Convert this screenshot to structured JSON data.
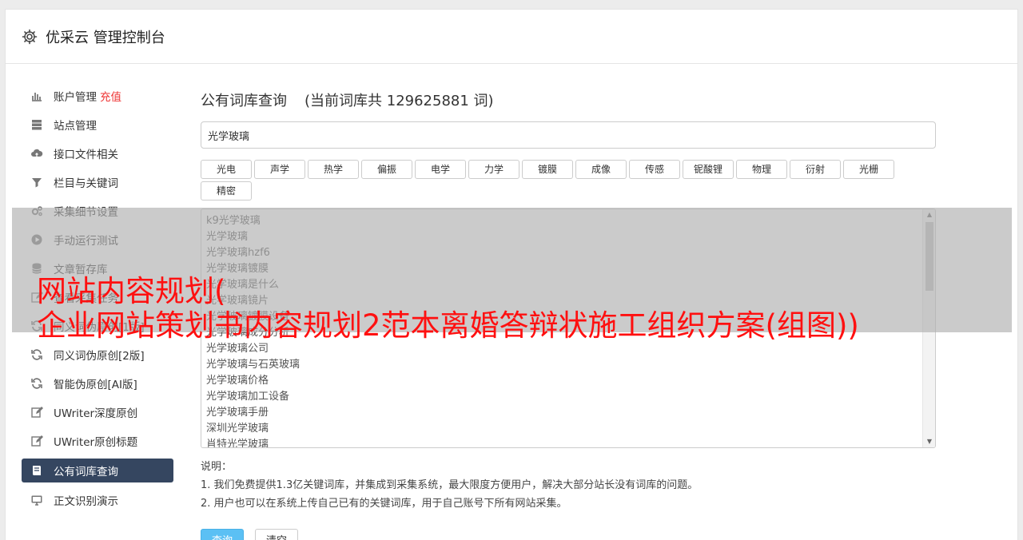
{
  "header": {
    "title": "优采云 管理控制台",
    "icon": "gear-icon"
  },
  "sidebar": {
    "items": [
      {
        "label": "账户管理",
        "badge": "充值",
        "icon": "bar-chart-icon"
      },
      {
        "label": "站点管理",
        "icon": "server-icon"
      },
      {
        "label": "接口文件相关",
        "icon": "cloud-upload-icon"
      },
      {
        "label": "栏目与关键词",
        "icon": "filter-icon"
      },
      {
        "label": "采集细节设置",
        "icon": "gears-icon"
      },
      {
        "label": "手动运行测试",
        "icon": "play-circle-icon"
      },
      {
        "label": "文章暂存库",
        "icon": "database-icon"
      },
      {
        "label": "查看采集任务",
        "icon": "edit-icon"
      },
      {
        "label": "同义词伪原创[1版]",
        "icon": "refresh-icon"
      },
      {
        "label": "同义词伪原创[2版]",
        "icon": "refresh-icon"
      },
      {
        "label": "智能伪原创[AI版]",
        "icon": "refresh-icon"
      },
      {
        "label": "UWriter深度原创",
        "icon": "edit-icon"
      },
      {
        "label": "UWriter原创标题",
        "icon": "edit-icon"
      },
      {
        "label": "公有词库查询",
        "icon": "book-icon",
        "active": true
      },
      {
        "label": "正文识别演示",
        "icon": "monitor-icon"
      }
    ]
  },
  "main": {
    "title": "公有词库查询",
    "count_text": "(当前词库共 129625881 词)",
    "search_value": "光学玻璃",
    "tags": [
      "光电",
      "声学",
      "热学",
      "偏振",
      "电学",
      "力学",
      "镀膜",
      "成像",
      "传感",
      "铌酸锂",
      "物理",
      "衍射",
      "光栅",
      "精密"
    ],
    "results": [
      "k9光学玻璃",
      "光学玻璃",
      "光学玻璃hzf6",
      "光学玻璃镀膜",
      "光学玻璃是什么",
      "光学玻璃镜片",
      "光学玻璃镀膜设备",
      "光学玻璃成分分析",
      "光学玻璃公司",
      "光学玻璃与石英玻璃",
      "光学玻璃价格",
      "光学玻璃加工设备",
      "光学玻璃手册",
      "深圳光学玻璃",
      "肖特光学玻璃"
    ],
    "notes": {
      "heading": "说明：",
      "lines": [
        "1. 我们免费提供1.3亿关键词库，并集成到采集系统，最大限度方便用户，解决大部分站长没有词库的问题。",
        "2. 用户也可以在系统上传自己已有的关键词库，用于自己账号下所有网站采集。"
      ]
    },
    "buttons": {
      "query": "查询",
      "clear": "清空"
    }
  },
  "overlay": {
    "line1": "网站内容规划(",
    "line2": "企业网站策划书内容规划2范本离婚答辩状施工组织方案(组图))"
  },
  "colors": {
    "sidebar_active": "#354660",
    "primary": "#5bc0f4",
    "badge": "#ee3333",
    "overlay_text": "#ff1010"
  }
}
